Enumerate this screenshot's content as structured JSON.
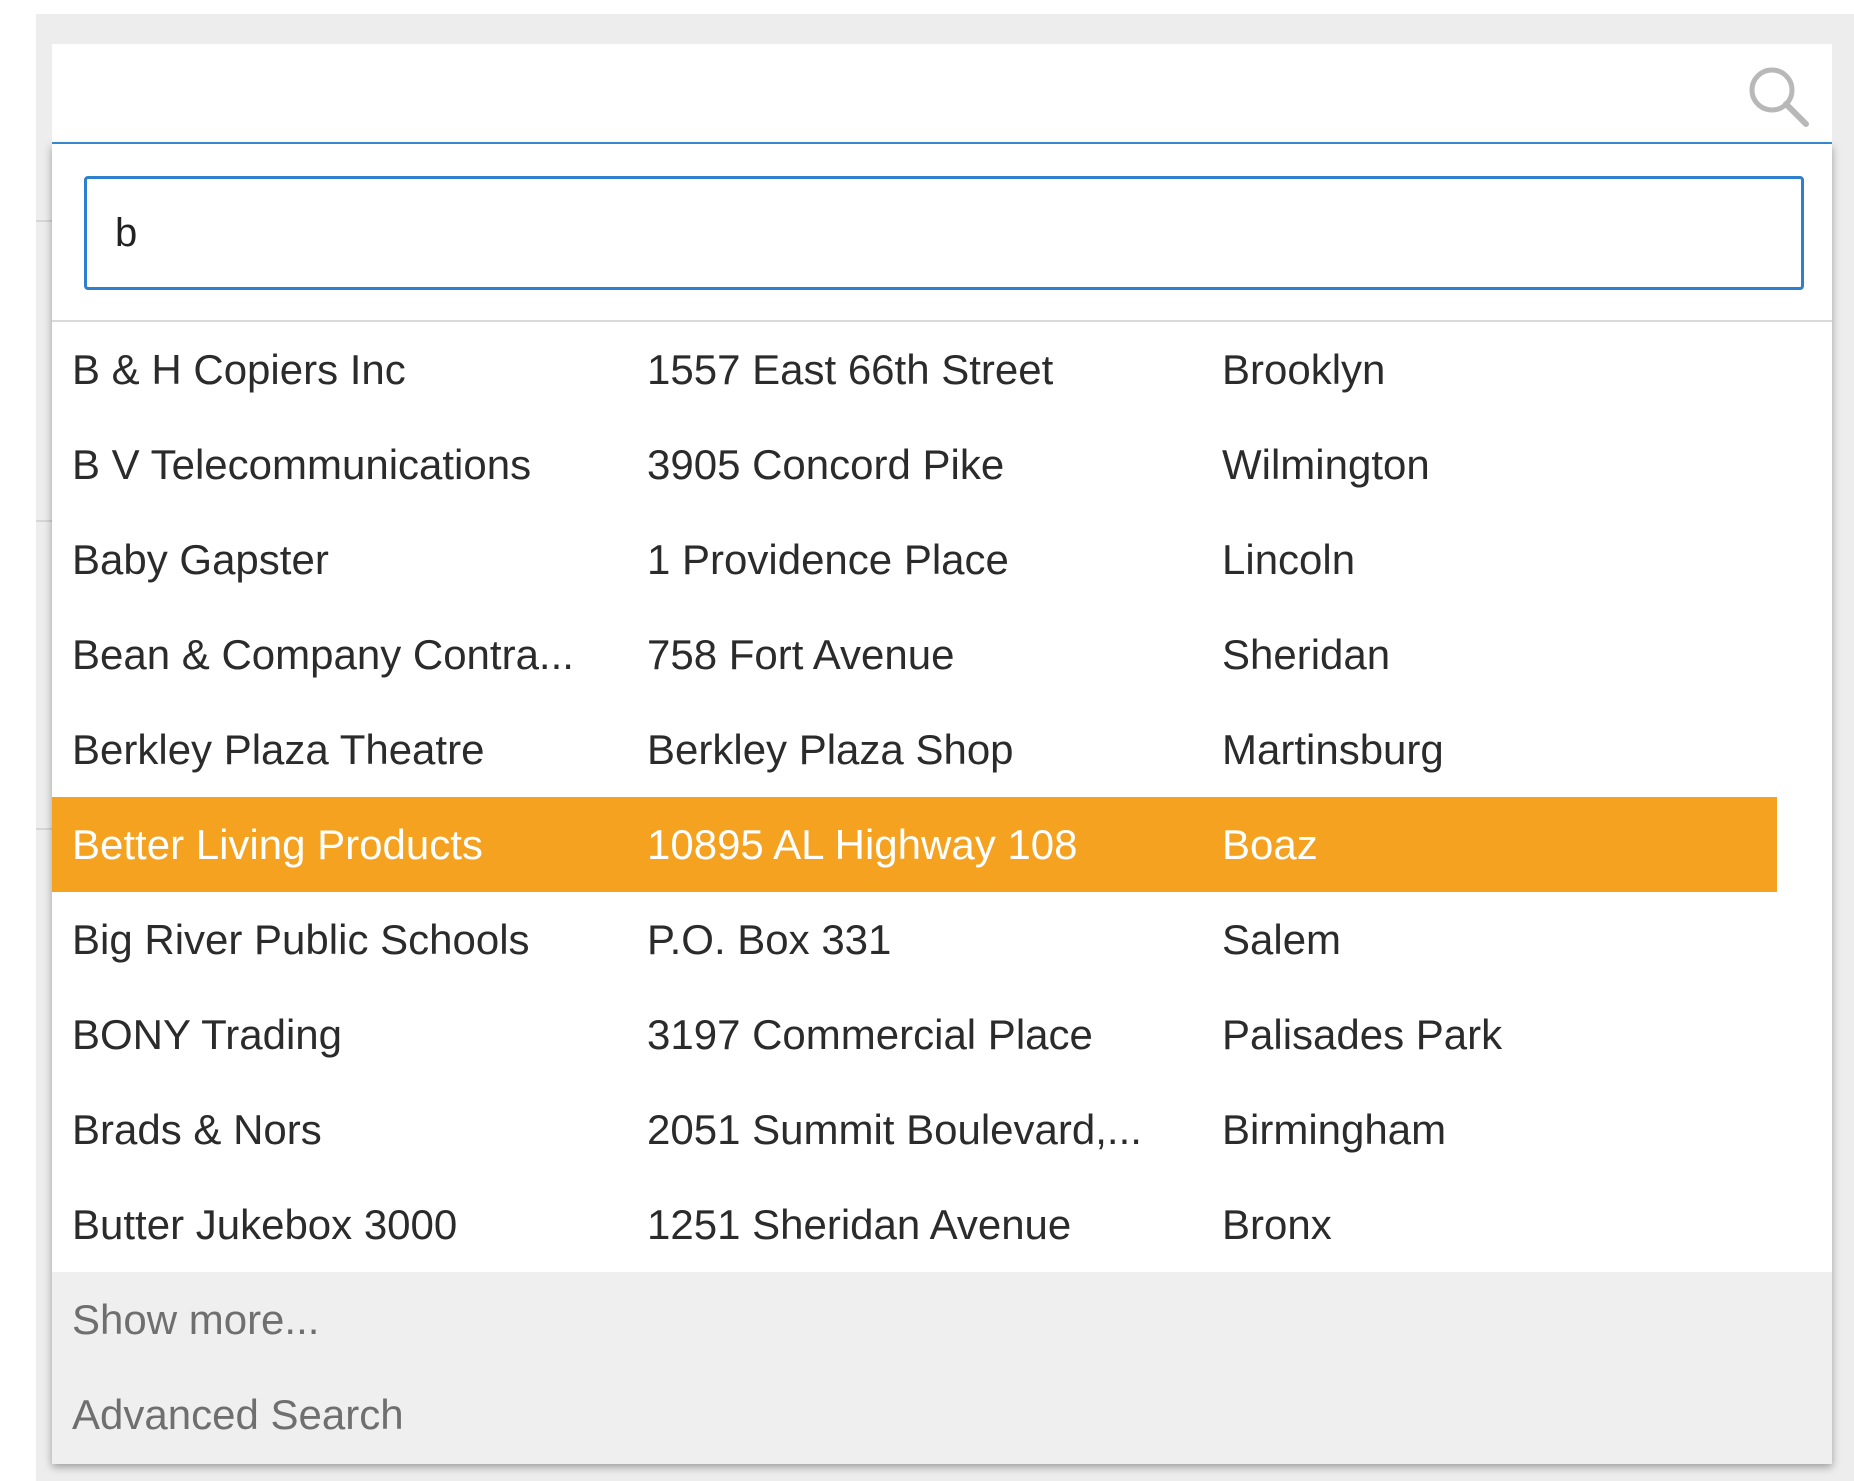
{
  "lookup": {
    "search_icon": "search-icon"
  },
  "filter": {
    "value": "b"
  },
  "results": [
    {
      "name": "B & H Copiers Inc",
      "address": "1557 East 66th Street",
      "city": "Brooklyn",
      "selected": false
    },
    {
      "name": "B V Telecommunications",
      "address": "3905 Concord Pike",
      "city": "Wilmington",
      "selected": false
    },
    {
      "name": "Baby Gapster",
      "address": "1 Providence Place",
      "city": "Lincoln",
      "selected": false
    },
    {
      "name": "Bean & Company Contra...",
      "address": "758 Fort Avenue",
      "city": "Sheridan",
      "selected": false
    },
    {
      "name": "Berkley Plaza Theatre",
      "address": "Berkley Plaza Shop",
      "city": "Martinsburg",
      "selected": false
    },
    {
      "name": "Better Living Products",
      "address": "10895 AL Highway 108",
      "city": "Boaz",
      "selected": true
    },
    {
      "name": "Big River Public Schools",
      "address": "P.O. Box 331",
      "city": "Salem",
      "selected": false
    },
    {
      "name": "BONY Trading",
      "address": "3197 Commercial Place",
      "city": "Palisades Park",
      "selected": false
    },
    {
      "name": "Brads & Nors",
      "address": "2051 Summit Boulevard,...",
      "city": "Birmingham",
      "selected": false
    },
    {
      "name": "Butter Jukebox 3000",
      "address": "1251 Sheridan Avenue",
      "city": "Bronx",
      "selected": false
    }
  ],
  "footer": {
    "show_more": "Show more...",
    "advanced_search": "Advanced Search"
  },
  "colors": {
    "selected_row": "#f5a221",
    "focus_border": "#2f7fd1",
    "footer_bg": "#efefef"
  }
}
